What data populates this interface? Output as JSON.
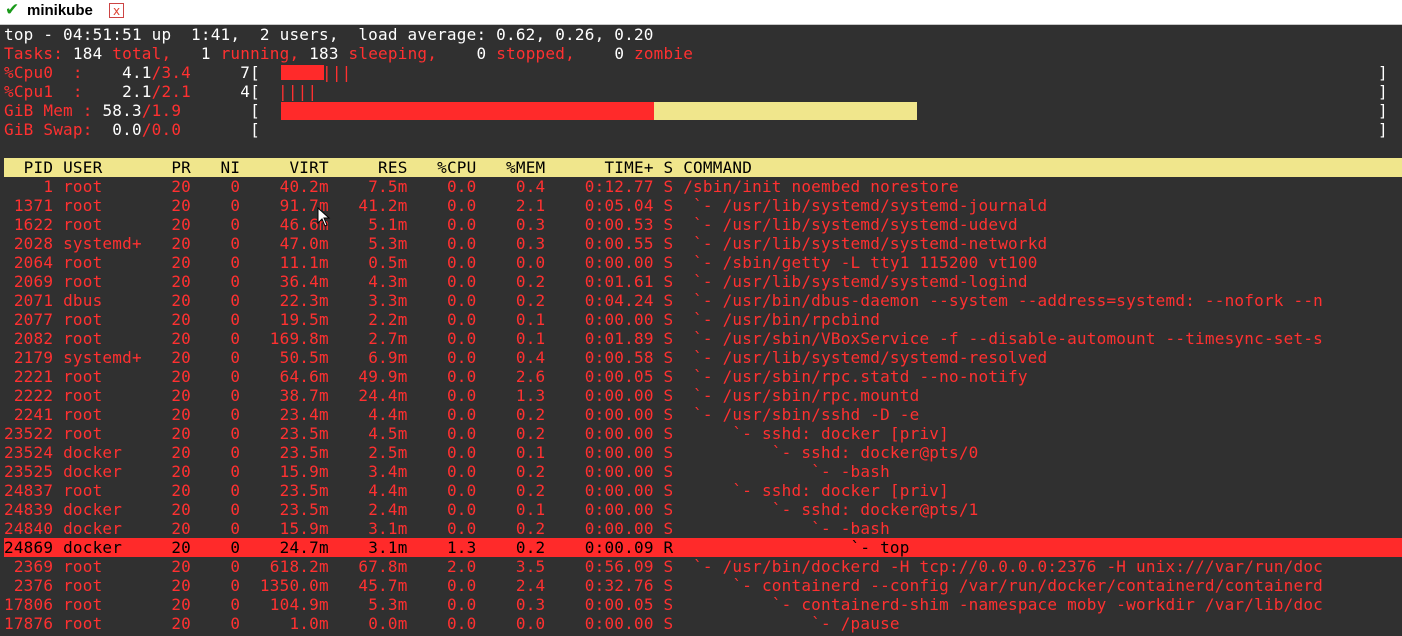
{
  "window": {
    "title": "minikube",
    "check_glyph": "✔",
    "close_glyph": "x"
  },
  "summary": {
    "uptime_line": "top - 04:51:51 up  1:41,  2 users,  load average: 0.62, 0.26, 0.20",
    "tasks": {
      "label": "Tasks:",
      "total": "184",
      "total_label": "total,",
      "running": "1",
      "running_label": "running,",
      "sleeping": "183",
      "sleeping_label": "sleeping,",
      "stopped": "0",
      "stopped_label": "stopped,",
      "zombie": "0",
      "zombie_label": "zombie"
    },
    "cpu0": {
      "label": "%Cpu0  :",
      "user": "4.1",
      "system": "/3.4",
      "total": "7",
      "used_fraction": 0.038
    },
    "cpu1": {
      "label": "%Cpu1  :",
      "user": "2.1",
      "system": "/2.1",
      "total": "4",
      "used_fraction": 0.038
    },
    "mem": {
      "label": "GiB Mem :",
      "used": "58.3",
      "other": "/1.9",
      "used_fraction": 0.338,
      "cache_fraction": 0.238
    },
    "swap": {
      "label": "GiB Swap:",
      "used": "0.0",
      "total": "/0.0",
      "used_fraction": 0
    }
  },
  "table": {
    "columns": [
      "PID",
      "USER",
      "PR",
      "NI",
      "VIRT",
      "RES",
      "%CPU",
      "%MEM",
      "TIME+",
      "S",
      "COMMAND"
    ],
    "rows": [
      {
        "pid": "1",
        "user": "root",
        "pr": "20",
        "ni": "0",
        "virt": "40.2m",
        "res": "7.5m",
        "cpu": "0.0",
        "mem": "0.4",
        "time": "0:12.77",
        "s": "S",
        "cmd": "/sbin/init noembed norestore"
      },
      {
        "pid": "1371",
        "user": "root",
        "pr": "20",
        "ni": "0",
        "virt": "91.7m",
        "res": "41.2m",
        "cpu": "0.0",
        "mem": "2.1",
        "time": "0:05.04",
        "s": "S",
        "cmd": " `- /usr/lib/systemd/systemd-journald"
      },
      {
        "pid": "1622",
        "user": "root",
        "pr": "20",
        "ni": "0",
        "virt": "46.6m",
        "res": "5.1m",
        "cpu": "0.0",
        "mem": "0.3",
        "time": "0:00.53",
        "s": "S",
        "cmd": " `- /usr/lib/systemd/systemd-udevd"
      },
      {
        "pid": "2028",
        "user": "systemd+",
        "pr": "20",
        "ni": "0",
        "virt": "47.0m",
        "res": "5.3m",
        "cpu": "0.0",
        "mem": "0.3",
        "time": "0:00.55",
        "s": "S",
        "cmd": " `- /usr/lib/systemd/systemd-networkd"
      },
      {
        "pid": "2064",
        "user": "root",
        "pr": "20",
        "ni": "0",
        "virt": "11.1m",
        "res": "0.5m",
        "cpu": "0.0",
        "mem": "0.0",
        "time": "0:00.00",
        "s": "S",
        "cmd": " `- /sbin/getty -L tty1 115200 vt100"
      },
      {
        "pid": "2069",
        "user": "root",
        "pr": "20",
        "ni": "0",
        "virt": "36.4m",
        "res": "4.3m",
        "cpu": "0.0",
        "mem": "0.2",
        "time": "0:01.61",
        "s": "S",
        "cmd": " `- /usr/lib/systemd/systemd-logind"
      },
      {
        "pid": "2071",
        "user": "dbus",
        "pr": "20",
        "ni": "0",
        "virt": "22.3m",
        "res": "3.3m",
        "cpu": "0.0",
        "mem": "0.2",
        "time": "0:04.24",
        "s": "S",
        "cmd": " `- /usr/bin/dbus-daemon --system --address=systemd: --nofork --n"
      },
      {
        "pid": "2077",
        "user": "root",
        "pr": "20",
        "ni": "0",
        "virt": "19.5m",
        "res": "2.2m",
        "cpu": "0.0",
        "mem": "0.1",
        "time": "0:00.00",
        "s": "S",
        "cmd": " `- /usr/bin/rpcbind"
      },
      {
        "pid": "2082",
        "user": "root",
        "pr": "20",
        "ni": "0",
        "virt": "169.8m",
        "res": "2.7m",
        "cpu": "0.0",
        "mem": "0.1",
        "time": "0:01.89",
        "s": "S",
        "cmd": " `- /usr/sbin/VBoxService -f --disable-automount --timesync-set-s"
      },
      {
        "pid": "2179",
        "user": "systemd+",
        "pr": "20",
        "ni": "0",
        "virt": "50.5m",
        "res": "6.9m",
        "cpu": "0.0",
        "mem": "0.4",
        "time": "0:00.58",
        "s": "S",
        "cmd": " `- /usr/lib/systemd/systemd-resolved"
      },
      {
        "pid": "2221",
        "user": "root",
        "pr": "20",
        "ni": "0",
        "virt": "64.6m",
        "res": "49.9m",
        "cpu": "0.0",
        "mem": "2.6",
        "time": "0:00.05",
        "s": "S",
        "cmd": " `- /usr/sbin/rpc.statd --no-notify"
      },
      {
        "pid": "2222",
        "user": "root",
        "pr": "20",
        "ni": "0",
        "virt": "38.7m",
        "res": "24.4m",
        "cpu": "0.0",
        "mem": "1.3",
        "time": "0:00.00",
        "s": "S",
        "cmd": " `- /usr/sbin/rpc.mountd"
      },
      {
        "pid": "2241",
        "user": "root",
        "pr": "20",
        "ni": "0",
        "virt": "23.4m",
        "res": "4.4m",
        "cpu": "0.0",
        "mem": "0.2",
        "time": "0:00.00",
        "s": "S",
        "cmd": " `- /usr/sbin/sshd -D -e"
      },
      {
        "pid": "23522",
        "user": "root",
        "pr": "20",
        "ni": "0",
        "virt": "23.5m",
        "res": "4.5m",
        "cpu": "0.0",
        "mem": "0.2",
        "time": "0:00.00",
        "s": "S",
        "cmd": "     `- sshd: docker [priv]"
      },
      {
        "pid": "23524",
        "user": "docker",
        "pr": "20",
        "ni": "0",
        "virt": "23.5m",
        "res": "2.5m",
        "cpu": "0.0",
        "mem": "0.1",
        "time": "0:00.00",
        "s": "S",
        "cmd": "         `- sshd: docker@pts/0"
      },
      {
        "pid": "23525",
        "user": "docker",
        "pr": "20",
        "ni": "0",
        "virt": "15.9m",
        "res": "3.4m",
        "cpu": "0.0",
        "mem": "0.2",
        "time": "0:00.00",
        "s": "S",
        "cmd": "             `- -bash"
      },
      {
        "pid": "24837",
        "user": "root",
        "pr": "20",
        "ni": "0",
        "virt": "23.5m",
        "res": "4.4m",
        "cpu": "0.0",
        "mem": "0.2",
        "time": "0:00.00",
        "s": "S",
        "cmd": "     `- sshd: docker [priv]"
      },
      {
        "pid": "24839",
        "user": "docker",
        "pr": "20",
        "ni": "0",
        "virt": "23.5m",
        "res": "2.4m",
        "cpu": "0.0",
        "mem": "0.1",
        "time": "0:00.00",
        "s": "S",
        "cmd": "         `- sshd: docker@pts/1"
      },
      {
        "pid": "24840",
        "user": "docker",
        "pr": "20",
        "ni": "0",
        "virt": "15.9m",
        "res": "3.1m",
        "cpu": "0.0",
        "mem": "0.2",
        "time": "0:00.00",
        "s": "S",
        "cmd": "             `- -bash"
      },
      {
        "pid": "24869",
        "user": "docker",
        "pr": "20",
        "ni": "0",
        "virt": "24.7m",
        "res": "3.1m",
        "cpu": "1.3",
        "mem": "0.2",
        "time": "0:00.09",
        "s": "R",
        "cmd": "                 `- top",
        "selected": true
      },
      {
        "pid": "2369",
        "user": "root",
        "pr": "20",
        "ni": "0",
        "virt": "618.2m",
        "res": "67.8m",
        "cpu": "2.0",
        "mem": "3.5",
        "time": "0:56.09",
        "s": "S",
        "cmd": " `- /usr/bin/dockerd -H tcp://0.0.0.0:2376 -H unix:///var/run/doc"
      },
      {
        "pid": "2376",
        "user": "root",
        "pr": "20",
        "ni": "0",
        "virt": "1350.0m",
        "res": "45.7m",
        "cpu": "0.0",
        "mem": "2.4",
        "time": "0:32.76",
        "s": "S",
        "cmd": "     `- containerd --config /var/run/docker/containerd/containerd"
      },
      {
        "pid": "17806",
        "user": "root",
        "pr": "20",
        "ni": "0",
        "virt": "104.9m",
        "res": "5.3m",
        "cpu": "0.0",
        "mem": "0.3",
        "time": "0:00.05",
        "s": "S",
        "cmd": "         `- containerd-shim -namespace moby -workdir /var/lib/doc"
      },
      {
        "pid": "17876",
        "user": "root",
        "pr": "20",
        "ni": "0",
        "virt": "1.0m",
        "res": "0.0m",
        "cpu": "0.0",
        "mem": "0.0",
        "time": "0:00.00",
        "s": "S",
        "cmd": "             `- /pause"
      }
    ]
  },
  "colors": {
    "background": "#303030",
    "text": "#ffffff",
    "accent_red": "#ff3030",
    "header_bar": "#f0e68c",
    "selected_row": "#ff2a2a"
  }
}
